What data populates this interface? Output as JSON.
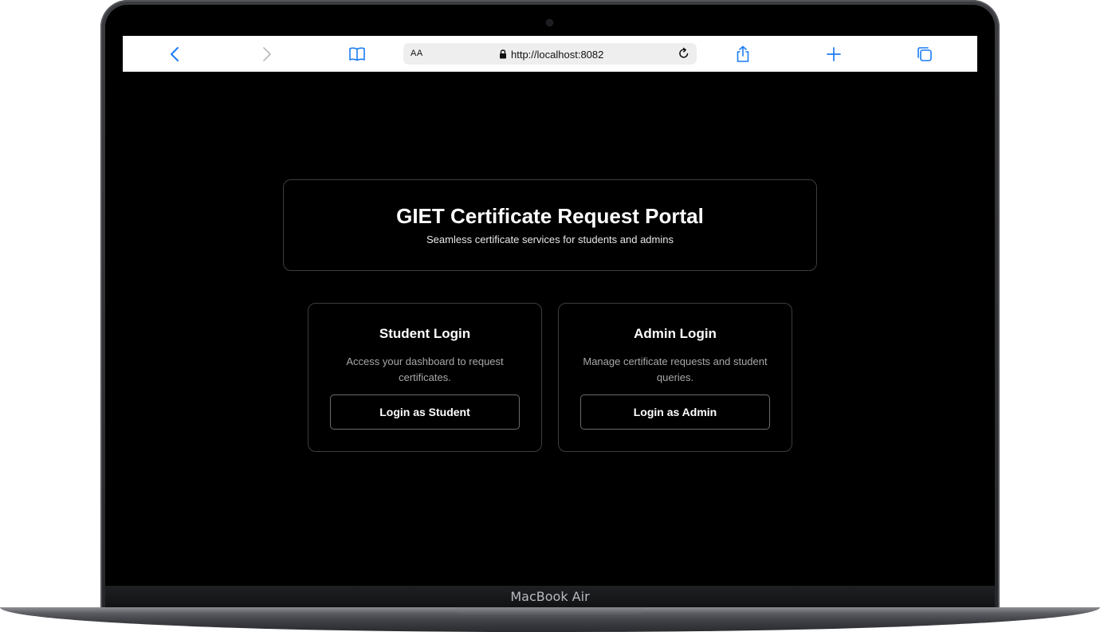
{
  "device": {
    "label": "MacBook Air"
  },
  "browser": {
    "aa_label": "AA",
    "url": "http://localhost:8082",
    "icons": [
      "back-icon",
      "forward-icon",
      "bookmarks-icon",
      "lock-icon",
      "reload-icon",
      "share-icon",
      "new-tab-icon",
      "tabs-icon"
    ]
  },
  "hero": {
    "title": "GIET Certificate Request Portal",
    "subtitle": "Seamless certificate services for students and admins"
  },
  "cards": {
    "student": {
      "title": "Student Login",
      "description": "Access your dashboard to request certificates.",
      "button_label": "Login as Student"
    },
    "admin": {
      "title": "Admin Login",
      "description": "Manage certificate requests and student queries.",
      "button_label": "Login as Admin"
    }
  },
  "colors": {
    "accent": "#1a7cf5",
    "page_background": "#000000",
    "card_border": "#3d3d3d",
    "muted_text": "#a8a8a8"
  }
}
